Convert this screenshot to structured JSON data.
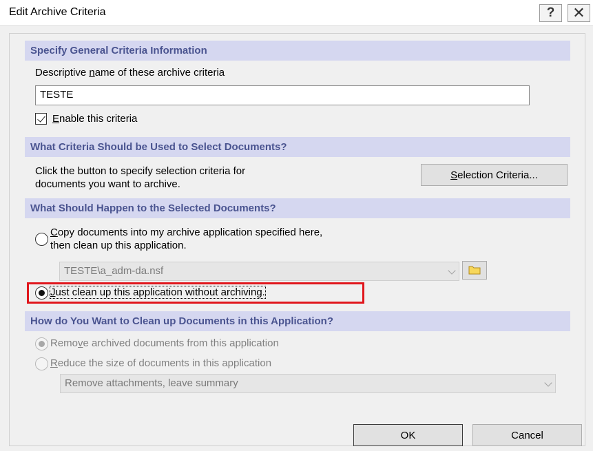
{
  "window": {
    "title": "Edit Archive Criteria",
    "help_label": "?",
    "close_label": "✕"
  },
  "section1": {
    "header": "Specify General Criteria Information",
    "name_label_pre": "Descriptive ",
    "name_label_key": "n",
    "name_label_post": "ame of these archive criteria",
    "name_value": "TESTE",
    "enable_key": "E",
    "enable_rest": "nable this criteria",
    "enable_checked": true
  },
  "section2": {
    "header": "What Criteria Should be Used to Select Documents?",
    "description_line1": "Click the button to specify selection criteria for",
    "description_line2": "documents you want to archive.",
    "button_key": "S",
    "button_rest": "election Criteria..."
  },
  "section3": {
    "header": "What Should Happen to the Selected Documents?",
    "copy_key": "C",
    "copy_line1_rest": "opy documents into my archive application specified here,",
    "copy_line2": "then clean up this application.",
    "archive_path": "TESTE\\a_adm-da.nsf",
    "clean_key": "J",
    "clean_rest": "ust clean up this application without archiving.",
    "selected_option": "clean_only",
    "highlight_color": "#e0161c"
  },
  "section4": {
    "header": "How do You Want to Clean up Documents in this Application?",
    "remove_pre": "Remo",
    "remove_key": "v",
    "remove_post": "e archived documents from this application",
    "reduce_key": "R",
    "reduce_rest": "educe the size of documents in this application",
    "reduce_option": "Remove attachments, leave summary"
  },
  "footer": {
    "ok_label": "OK",
    "cancel_label": "Cancel"
  },
  "colors": {
    "section_header_bg": "#d5d7f0",
    "section_header_text": "#4a5490"
  }
}
